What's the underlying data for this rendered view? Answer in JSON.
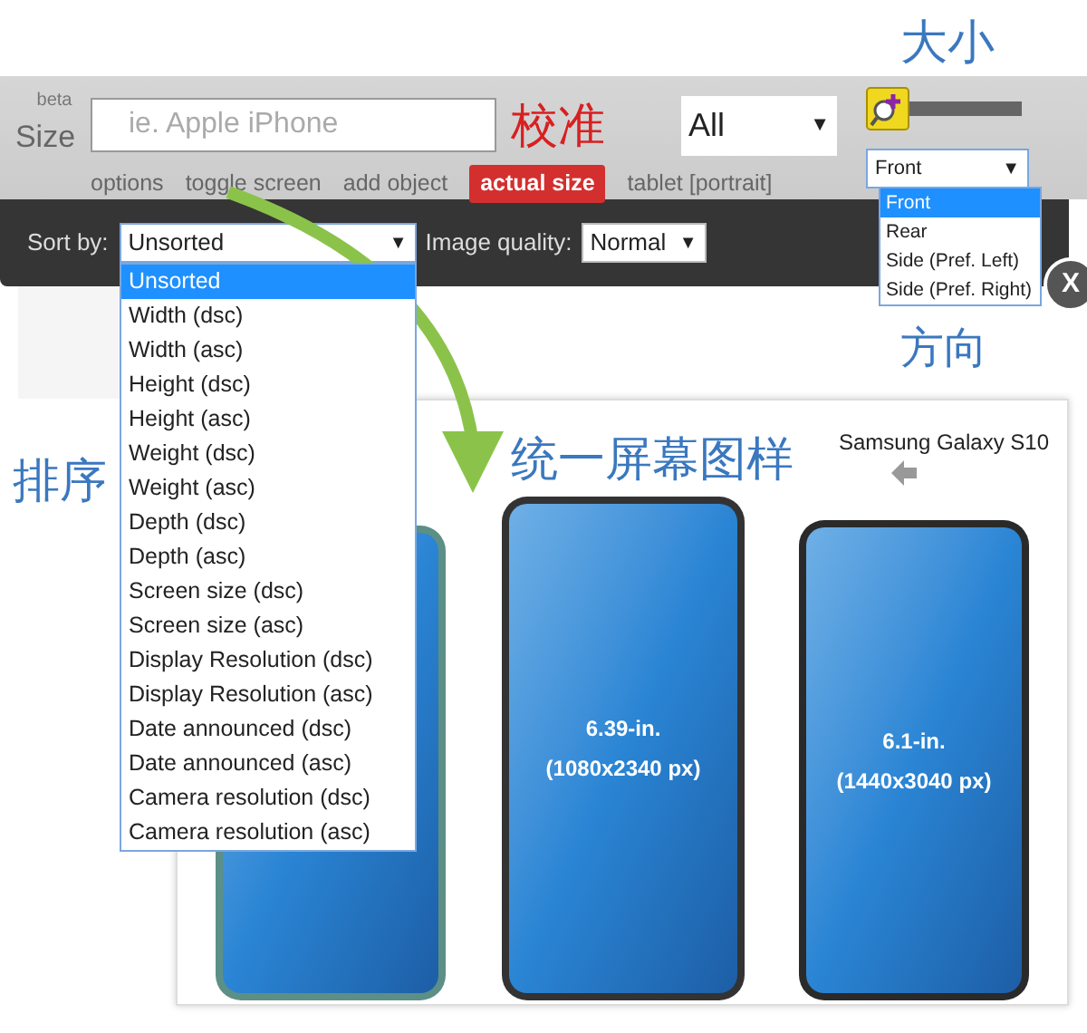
{
  "annotations": {
    "size": "大小",
    "calibrate": "校准",
    "direction": "方向",
    "sort": "排序",
    "unified": "统一屏幕图样"
  },
  "header": {
    "beta": "beta",
    "size_label": "Size",
    "search": {
      "placeholder": "ie. Apple iPhone"
    },
    "category": {
      "value": "All",
      "caret": "▼"
    },
    "links": [
      {
        "label": "options",
        "selected": false
      },
      {
        "label": "toggle screen",
        "selected": false
      },
      {
        "label": "add object",
        "selected": false
      },
      {
        "label": "actual size",
        "selected": true
      },
      {
        "label": "tablet [portrait]",
        "selected": false
      }
    ],
    "zoom_slider": {
      "level": 0
    },
    "view": {
      "value": "Front",
      "caret": "▼",
      "expanded": true,
      "options": [
        {
          "label": "Front",
          "selected": true
        },
        {
          "label": "Rear",
          "selected": false
        },
        {
          "label": "Side (Pref. Left)",
          "selected": false
        },
        {
          "label": "Side (Pref. Right)",
          "selected": false
        }
      ]
    }
  },
  "toolbar": {
    "sort_label": "Sort by:",
    "sort": {
      "value": "Unsorted",
      "caret": "▼",
      "expanded": true,
      "options": [
        {
          "label": "Unsorted",
          "selected": true
        },
        {
          "label": "Width (dsc)",
          "selected": false
        },
        {
          "label": "Width (asc)",
          "selected": false
        },
        {
          "label": "Height (dsc)",
          "selected": false
        },
        {
          "label": "Height (asc)",
          "selected": false
        },
        {
          "label": "Weight (dsc)",
          "selected": false
        },
        {
          "label": "Weight (asc)",
          "selected": false
        },
        {
          "label": "Depth (dsc)",
          "selected": false
        },
        {
          "label": "Depth (asc)",
          "selected": false
        },
        {
          "label": "Screen size (dsc)",
          "selected": false
        },
        {
          "label": "Screen size (asc)",
          "selected": false
        },
        {
          "label": "Display Resolution (dsc)",
          "selected": false
        },
        {
          "label": "Display Resolution (asc)",
          "selected": false
        },
        {
          "label": "Date announced (dsc)",
          "selected": false
        },
        {
          "label": "Date announced (asc)",
          "selected": false
        },
        {
          "label": "Camera resolution (dsc)",
          "selected": false
        },
        {
          "label": "Camera resolution (asc)",
          "selected": false
        }
      ]
    },
    "quality_label": "Image quality:",
    "quality": {
      "value": "Normal",
      "caret": "▼"
    }
  },
  "close_button": "X",
  "comparison": {
    "device_name": "Samsung Galaxy S10",
    "phones": [
      {
        "screen_size": "6.39-in.",
        "resolution": "(1080x2340 px)"
      },
      {
        "screen_size": "6.1-in.",
        "resolution": "(1440x3040 px)"
      }
    ]
  }
}
